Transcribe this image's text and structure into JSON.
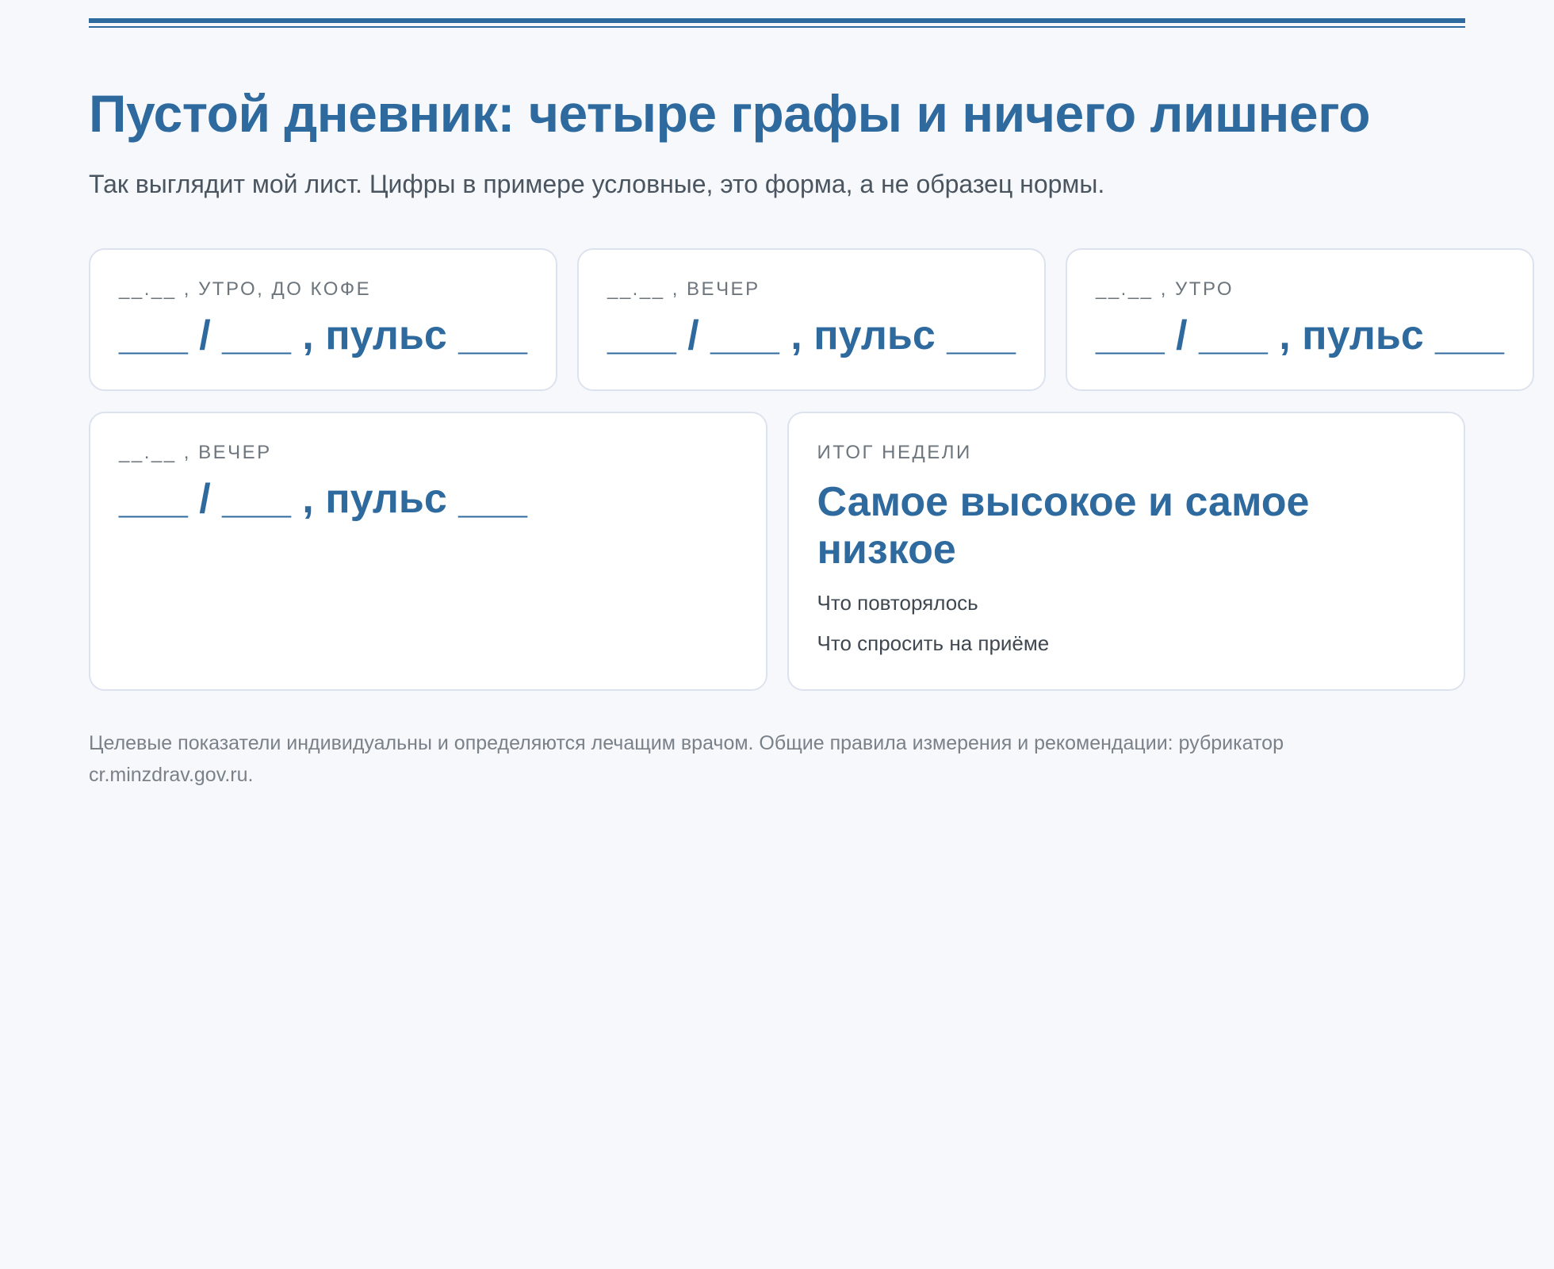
{
  "header": {
    "title": "Пустой дневник: четыре графы и ничего лишнего",
    "lead": "Так выглядит мой лист. Цифры в примере условные, это форма, а не образец нормы."
  },
  "entries": [
    {
      "label": "__.__ , утро, до кофе",
      "value": "___ / ___ , пульс ___"
    },
    {
      "label": "__.__ , вечер",
      "value": "___ / ___ , пульс ___"
    },
    {
      "label": "__.__ , утро",
      "value": "___ / ___ , пульс ___"
    },
    {
      "label": "__.__ , вечер",
      "value": "___ / ___ , пульс ___"
    }
  ],
  "summary": {
    "label": "Итог недели",
    "title": "Самое высокое и самое низкое",
    "items": [
      "Что повторялось",
      "Что спросить на приёме"
    ]
  },
  "footnote": "Целевые показатели индивидуальны и определяются лечащим врачом. Общие правила измерения и рекомендации: рубрикатор cr.minzdrav.gov.ru.",
  "colors": {
    "accent": "#2f6a9e",
    "background": "#f6f8fc",
    "card_border": "#dde3ee"
  }
}
